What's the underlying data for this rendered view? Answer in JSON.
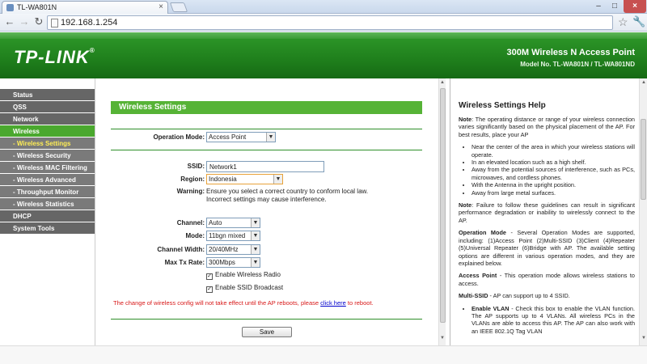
{
  "browser": {
    "tab_title": "TL-WA801N",
    "tab_close": "×",
    "url": "192.168.1.254",
    "win_min": "–",
    "win_max": "□",
    "win_close": "×"
  },
  "banner": {
    "logo": "TP-LINK",
    "logo_reg": "®",
    "product": "300M Wireless N Access Point",
    "model": "Model No. TL-WA801N / TL-WA801ND"
  },
  "sidebar": {
    "items": [
      {
        "label": "Status"
      },
      {
        "label": "QSS"
      },
      {
        "label": "Network"
      },
      {
        "label": "Wireless"
      },
      {
        "label": "- Wireless Settings"
      },
      {
        "label": "- Wireless Security"
      },
      {
        "label": "- Wireless MAC Filtering"
      },
      {
        "label": "- Wireless Advanced"
      },
      {
        "label": "- Throughput Monitor"
      },
      {
        "label": "- Wireless Statistics"
      },
      {
        "label": "DHCP"
      },
      {
        "label": "System Tools"
      }
    ]
  },
  "main": {
    "section_title": "Wireless Settings",
    "operation_mode_label": "Operation Mode:",
    "operation_mode_value": "Access Point",
    "ssid_label": "SSID:",
    "ssid_value": "Network1",
    "region_label": "Region:",
    "region_value": "Indonesia",
    "warning_label": "Warning:",
    "warning_line1": "Ensure you select a correct country to conform local law.",
    "warning_line2": "Incorrect settings may cause interference.",
    "channel_label": "Channel:",
    "channel_value": "Auto",
    "mode_label": "Mode:",
    "mode_value": "11bgn mixed",
    "channel_width_label": "Channel Width:",
    "channel_width_value": "20/40MHz",
    "max_tx_label": "Max Tx Rate:",
    "max_tx_value": "300Mbps",
    "enable_radio_label": "Enable Wireless Radio",
    "enable_ssid_label": "Enable SSID Broadcast",
    "notice_text": "The change of wireless config will not take effect until the AP reboots, please",
    "notice_link": "click here",
    "notice_suffix": "to reboot.",
    "save_label": "Save"
  },
  "help": {
    "title": "Wireless Settings Help",
    "note1_label": "Note",
    "note1_text": ": The operating distance or range of your wireless connection varies significantly based on the physical placement of the AP. For best results, place your AP",
    "bullets": [
      "Near the center of the area in which your wireless stations will operate.",
      "In an elevated location such as a high shelf.",
      "Away from the potential sources of interference, such as PCs, microwaves, and cordless phones.",
      "With the Antenna in the upright position.",
      "Away from large metal surfaces."
    ],
    "note2_label": "Note",
    "note2_text": ": Failure to follow these guidelines can result in significant performance degradation or inability to wirelessly connect to the AP.",
    "opmode_label": "Operation Mode",
    "opmode_text": " - Several Operation Modes are supported, including: (1)Access Point (2)Multi-SSID (3)Client (4)Repeater (5)Universal Repeater (6)Bridge with AP. The available setting options are different in various operation modes, and they are explained below.",
    "ap_label": "Access Point",
    "ap_text": " - This operation mode allows wireless stations to access.",
    "multissid_label": "Multi-SSID",
    "multissid_text": " - AP can support up to 4 SSID.",
    "vlan_label": "Enable VLAN",
    "vlan_text": " - Check this box to enable the VLAN function. The AP supports up to 4 VLANs. All wireless PCs in the VLANs are able to access this AP. The AP can also work with an IEEE 802.1Q Tag VLAN"
  }
}
